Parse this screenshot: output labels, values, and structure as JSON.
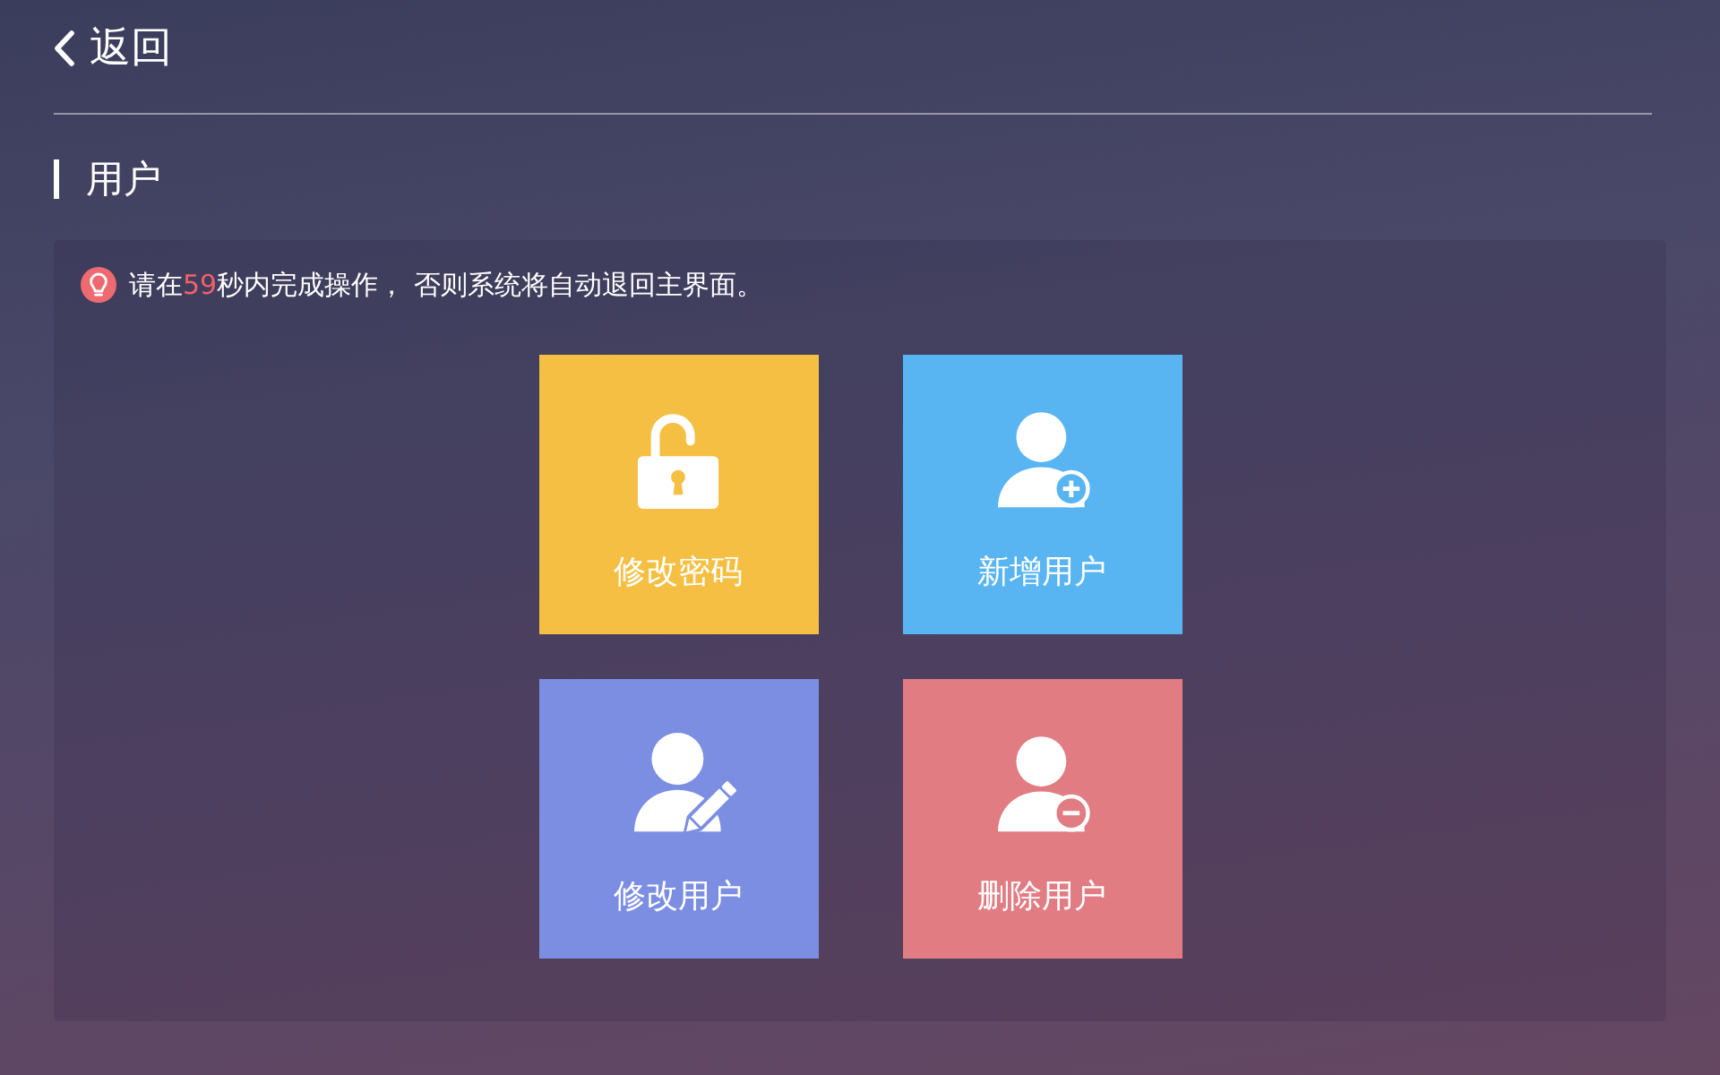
{
  "header": {
    "back_label": "返回"
  },
  "section": {
    "title": "用户"
  },
  "notice": {
    "text_before": "请在",
    "countdown": "59",
    "text_after": "秒内完成操作， 否则系统将自动退回主界面。"
  },
  "tiles": [
    {
      "kind": "unlock",
      "label": "修改密码",
      "color": "#f5bf43"
    },
    {
      "kind": "user-add",
      "label": "新增用户",
      "color": "#58b5f2"
    },
    {
      "kind": "user-edit",
      "label": "修改用户",
      "color": "#7b8ee2"
    },
    {
      "kind": "user-remove",
      "label": "删除用户",
      "color": "#e17c83"
    }
  ]
}
